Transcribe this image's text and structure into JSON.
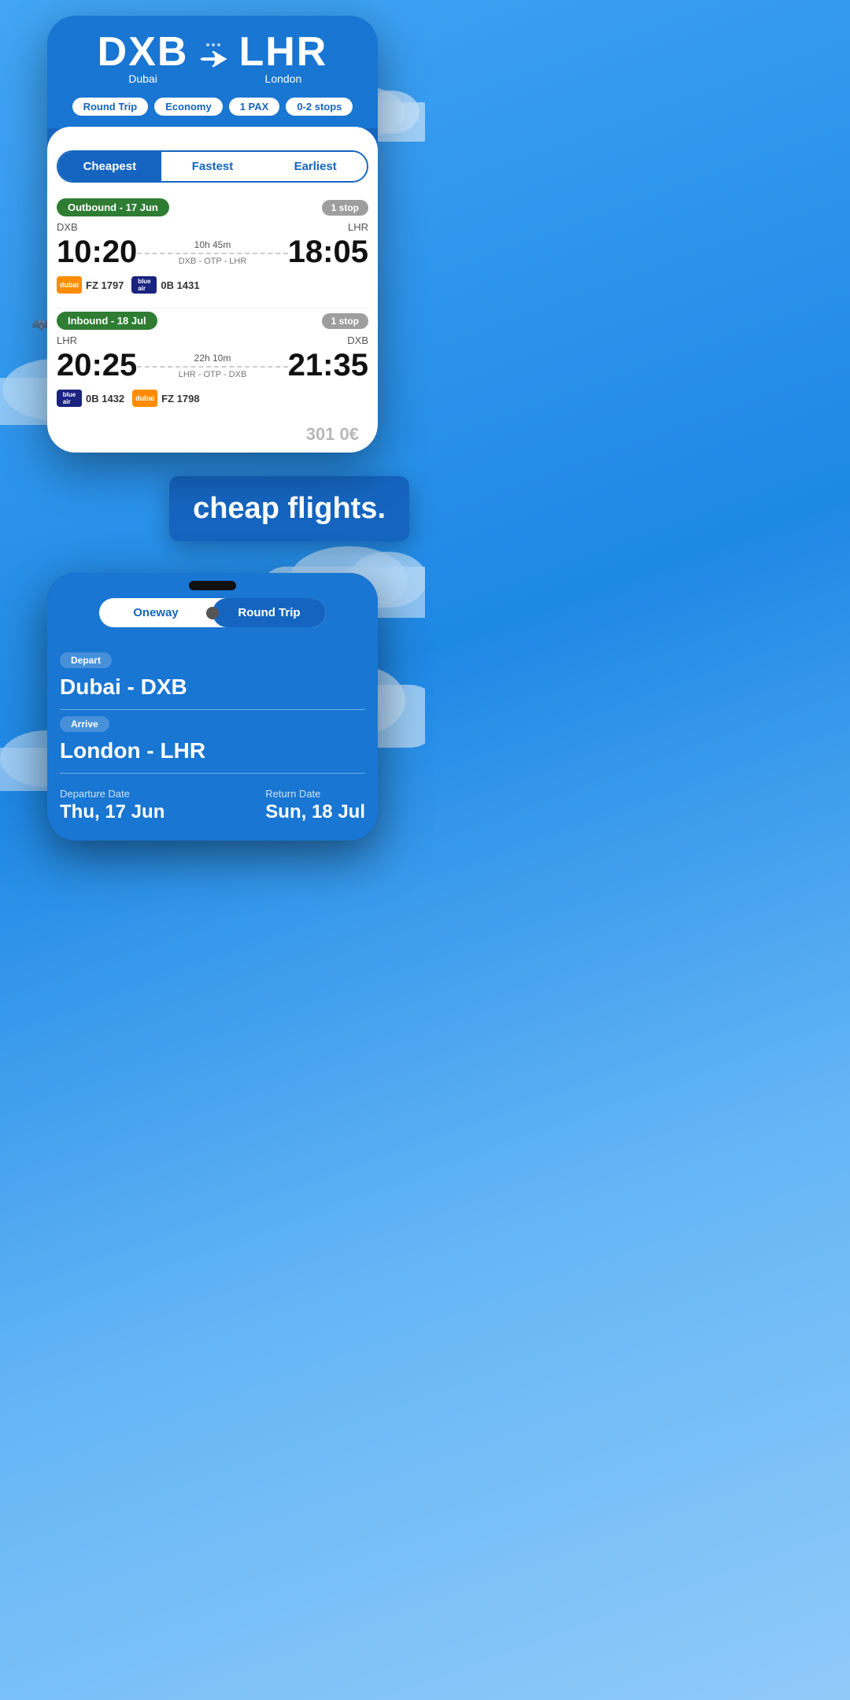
{
  "app": {
    "title": "cheap flights."
  },
  "top_phone": {
    "origin_code": "DXB",
    "origin_name": "Dubai",
    "destination_code": "LHR",
    "destination_name": "London",
    "filters": {
      "trip_type": "Round Trip",
      "cabin": "Economy",
      "passengers": "1 PAX",
      "stops": "0-2 stops"
    },
    "tabs": {
      "cheapest": "Cheapest",
      "fastest": "Fastest",
      "earliest": "Earliest"
    },
    "outbound": {
      "label": "Outbound - 17 Jun",
      "stops": "1 stop",
      "from": "DXB",
      "to": "LHR",
      "departure": "10:20",
      "arrival": "18:05",
      "duration": "10h 45m",
      "route": "DXB - OTP - LHR",
      "flight1_airline": "dubai",
      "flight1_number": "FZ 1797",
      "flight2_airline": "blue",
      "flight2_number": "0B 1431"
    },
    "inbound": {
      "label": "Inbound - 18 Jul",
      "stops": "1 stop",
      "from": "LHR",
      "to": "DXB",
      "departure": "20:25",
      "arrival": "21:35",
      "duration": "22h 10m",
      "route": "LHR - OTP - DXB",
      "flight1_airline": "blue",
      "flight1_number": "0B 1432",
      "flight2_airline": "dubai",
      "flight2_number": "FZ 1798"
    }
  },
  "bottom_phone": {
    "trip_toggle": {
      "oneway": "Oneway",
      "round_trip": "Round Trip"
    },
    "depart_label": "Depart",
    "depart_value": "Dubai - DXB",
    "arrive_label": "Arrive",
    "arrive_value": "London - LHR",
    "departure_date_label": "Departure Date",
    "departure_date_value": "Thu, 17 Jun",
    "return_date_label": "Return Date",
    "return_date_value": "Sun, 18 Jul"
  }
}
